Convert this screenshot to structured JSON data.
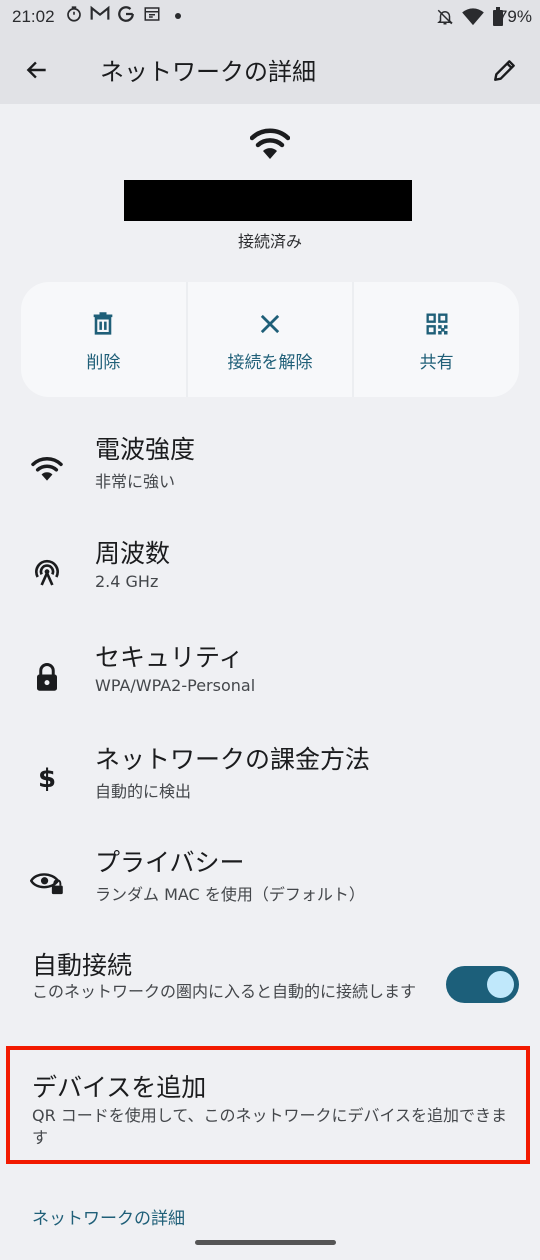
{
  "status_bar": {
    "time": "21:02",
    "left_icons": [
      "timer-icon",
      "gmail-icon",
      "google-icon",
      "calendar-icon",
      "dot-icon"
    ],
    "right_icons": [
      "bell-off-icon",
      "wifi-icon",
      "battery-icon"
    ],
    "battery": "79%"
  },
  "app_bar": {
    "title": "ネットワークの詳細"
  },
  "header": {
    "status": "接続済み"
  },
  "actions": [
    {
      "label": "削除",
      "icon": "trash-icon"
    },
    {
      "label": "接続を解除",
      "icon": "close-icon"
    },
    {
      "label": "共有",
      "icon": "qr-code-icon"
    }
  ],
  "details": [
    {
      "title": "電波強度",
      "value": "非常に強い",
      "icon": "wifi-icon"
    },
    {
      "title": "周波数",
      "value": "2.4 GHz",
      "icon": "antenna-icon"
    },
    {
      "title": "セキュリティ",
      "value": "WPA/WPA2-Personal",
      "icon": "lock-icon"
    },
    {
      "title": "ネットワークの課金方法",
      "value": "自動的に検出",
      "icon": "dollar-icon"
    },
    {
      "title": "プライバシー",
      "value": "ランダム MAC を使用（デフォルト）",
      "icon": "privacy-eye-icon"
    }
  ],
  "auto_connect": {
    "title": "自動接続",
    "description": "このネットワークの圏内に入ると自動的に接続します",
    "enabled": true
  },
  "add_device": {
    "title": "デバイスを追加",
    "description": "QR コードを使用して、このネットワークにデバイスを追加できます"
  },
  "network_details_link": "ネットワークの詳細",
  "colors": {
    "accent": "#1f5f78",
    "toggle_on": "#1c5f7a",
    "highlight": "#f21a00"
  }
}
